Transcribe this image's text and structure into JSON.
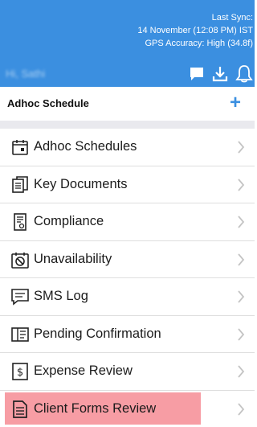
{
  "header": {
    "sync_line1": "Last Sync:",
    "sync_line2": "14 November (12:08 PM) IST",
    "sync_line3": "GPS Accuracy: High (34.8f)",
    "greeting": "Hi, Sathi",
    "background_color": "#3b8fe0",
    "icons": [
      "chat-icon",
      "download-icon",
      "bell-icon"
    ]
  },
  "page": {
    "title": "Adhoc Schedule",
    "add_label": "+"
  },
  "menu": {
    "items": [
      {
        "label": "Adhoc Schedules",
        "icon": "calendar-icon"
      },
      {
        "label": "Key Documents",
        "icon": "documents-icon"
      },
      {
        "label": "Compliance",
        "icon": "compliance-icon"
      },
      {
        "label": "Unavailability",
        "icon": "unavailability-icon"
      },
      {
        "label": "SMS Log",
        "icon": "message-icon"
      },
      {
        "label": "Pending Confirmation",
        "icon": "pending-icon"
      },
      {
        "label": "Expense Review",
        "icon": "dollar-icon"
      },
      {
        "label": "Client Forms Review",
        "icon": "form-icon",
        "highlighted": true,
        "highlight_color": "#f47c86"
      }
    ]
  }
}
